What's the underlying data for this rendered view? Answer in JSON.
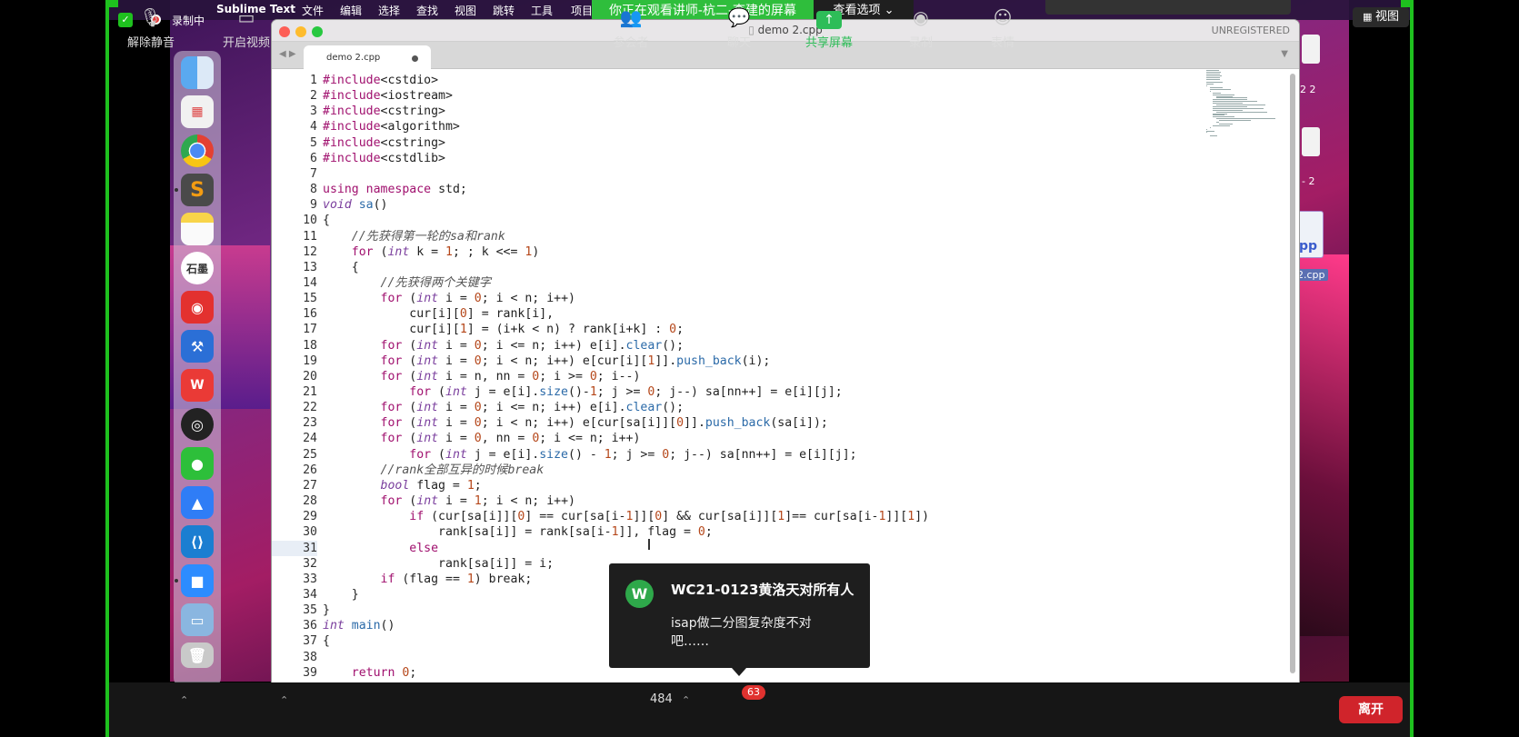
{
  "zoom": {
    "recording_label": "录制中",
    "banner": "你正在观看讲师-杭二-李建的屏幕",
    "view_options": "查看选项 ⌄",
    "view_button": "视图",
    "toolbar": {
      "mute": "解除静音",
      "video": "开启视频",
      "participants": "参会者",
      "participants_count": "484",
      "chat": "聊天",
      "chat_badge": "63",
      "share": "共享屏幕",
      "record": "录制",
      "reactions": "表情",
      "leave": "离开"
    },
    "notification": {
      "avatar_letter": "W",
      "title": "WC21-0123黄洛天对所有人",
      "body": "isap做二分图复杂度不对吧……"
    }
  },
  "macos": {
    "menu": [
      "Sublime Text",
      "文件",
      "编辑",
      "选择",
      "查找",
      "视图",
      "跳转",
      "工具",
      "项目"
    ],
    "dock_shimo_label": "石墨",
    "desktop_labels": [
      "2 2",
      "- 2",
      "pp",
      "2.cpp"
    ]
  },
  "sublime": {
    "window_title": "demo 2.cpp",
    "unregistered": "UNREGISTERED",
    "tab_label": "demo 2.cpp",
    "current_line": 31,
    "lines": [
      "#include<cstdio>",
      "#include<iostream>",
      "#include<cstring>",
      "#include<algorithm>",
      "#include<cstring>",
      "#include<cstdlib>",
      "",
      "using namespace std;",
      "void sa()",
      "{",
      "    //先获得第一轮的sa和rank",
      "    for (int k = 1; ; k <<= 1)",
      "    {",
      "        //先获得两个关键字",
      "        for (int i = 0; i < n; i++)",
      "            cur[i][0] = rank[i],",
      "            cur[i][1] = (i+k < n) ? rank[i+k] : 0;",
      "        for (int i = 0; i <= n; i++) e[i].clear();",
      "        for (int i = 0; i < n; i++) e[cur[i][1]].push_back(i);",
      "        for (int i = n, nn = 0; i >= 0; i--)",
      "            for (int j = e[i].size()-1; j >= 0; j--) sa[nn++] = e[i][j];",
      "        for (int i = 0; i <= n; i++) e[i].clear();",
      "        for (int i = 0; i < n; i++) e[cur[sa[i]][0]].push_back(sa[i]);",
      "        for (int i = 0, nn = 0; i <= n; i++)",
      "            for (int j = e[i].size() - 1; j >= 0; j--) sa[nn++] = e[i][j];",
      "        //rank全部互异的时候break",
      "        bool flag = 1;",
      "        for (int i = 1; i < n; i++)",
      "            if (cur[sa[i]][0] == cur[sa[i-1]][0] && cur[sa[i]][1]== cur[sa[i-1]][1])",
      "                rank[sa[i]] = rank[sa[i-1]], flag = 0;",
      "            else",
      "                rank[sa[i]] = i;",
      "        if (flag == 1) break;",
      "    }",
      "}",
      "int main()",
      "{",
      "",
      "    return 0;"
    ]
  },
  "colors": {
    "zoom_green": "#1ec11e",
    "banner_green": "#2fbe3c",
    "leave_red": "#d0242b",
    "badge_red": "#e0322f"
  }
}
